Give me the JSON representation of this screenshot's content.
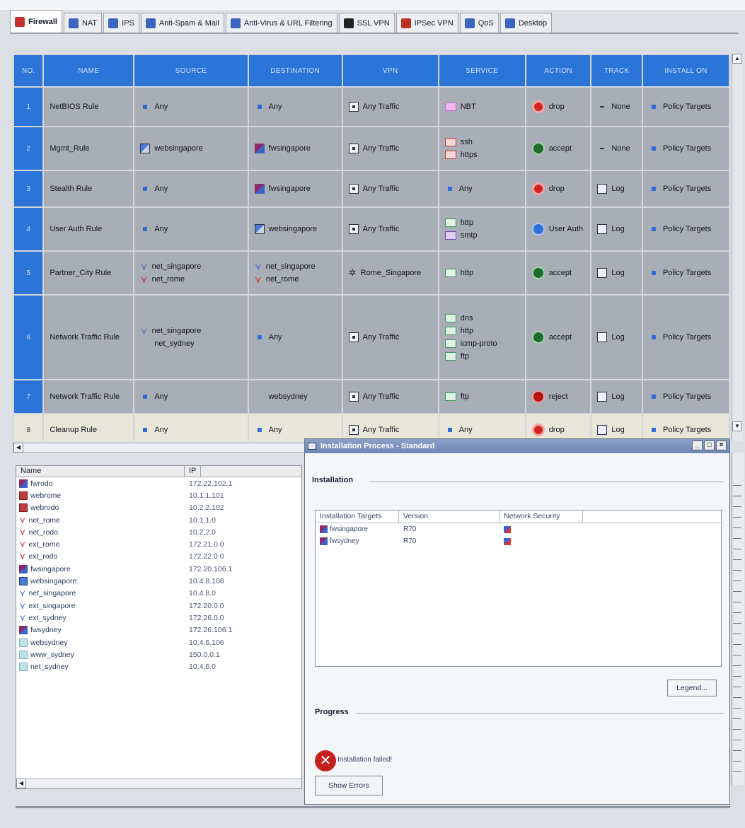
{
  "tabs": [
    {
      "label": "Firewall",
      "color": "#c43030"
    },
    {
      "label": "NAT",
      "color": "#3b64c0"
    },
    {
      "label": "IPS",
      "color": "#3b64c0"
    },
    {
      "label": "Anti-Spam & Mail",
      "color": "#3b64c0"
    },
    {
      "label": "Anti-Virus & URL Filtering",
      "color": "#3b64c0"
    },
    {
      "label": "SSL VPN",
      "color": "#222222"
    },
    {
      "label": "IPSec VPN",
      "color": "#b8321f"
    },
    {
      "label": "QoS",
      "color": "#3b64c0"
    },
    {
      "label": "Desktop",
      "color": "#3b64c0"
    }
  ],
  "rulebase": {
    "headers": [
      "NO.",
      "NAME",
      "SOURCE",
      "DESTINATION",
      "VPN",
      "SERVICE",
      "ACTION",
      "TRACK",
      "INSTALL ON"
    ],
    "rows": [
      {
        "no": "1",
        "name": "NetBIOS Rule",
        "source": [
          {
            "icon": "dot",
            "text": "Any"
          }
        ],
        "destination": [
          {
            "icon": "dot",
            "text": "Any"
          }
        ],
        "vpn": [
          {
            "icon": "vpnbox",
            "text": "Any Traffic"
          }
        ],
        "service": [
          {
            "icon": "svc pink",
            "text": "NBT"
          }
        ],
        "action": {
          "icon": "drop",
          "text": "drop"
        },
        "track": {
          "icon": "none",
          "text": "None"
        },
        "install": "Policy Targets"
      },
      {
        "no": "2",
        "name": "Mgmt_Rule",
        "source": [
          {
            "icon": "host",
            "text": "websingapore"
          }
        ],
        "destination": [
          {
            "icon": "gw",
            "text": "fwsingapore"
          }
        ],
        "vpn": [
          {
            "icon": "vpnbox",
            "text": "Any Traffic"
          }
        ],
        "service": [
          {
            "icon": "svc red",
            "text": "ssh"
          },
          {
            "icon": "svc red",
            "text": "https"
          }
        ],
        "action": {
          "icon": "accept",
          "text": "accept"
        },
        "track": {
          "icon": "none",
          "text": "None"
        },
        "install": "Policy Targets"
      },
      {
        "no": "3",
        "name": "Stealth Rule",
        "source": [
          {
            "icon": "dot",
            "text": "Any"
          }
        ],
        "destination": [
          {
            "icon": "gw",
            "text": "fwsingapore"
          }
        ],
        "vpn": [
          {
            "icon": "vpnbox",
            "text": "Any Traffic"
          }
        ],
        "service": [
          {
            "icon": "dot",
            "text": "Any"
          }
        ],
        "action": {
          "icon": "drop",
          "text": "drop"
        },
        "track": {
          "icon": "log",
          "text": "Log"
        },
        "install": "Policy Targets"
      },
      {
        "no": "4",
        "name": "User Auth Rule",
        "source": [
          {
            "icon": "dot",
            "text": "Any"
          }
        ],
        "destination": [
          {
            "icon": "host",
            "text": "websingapore"
          }
        ],
        "vpn": [
          {
            "icon": "vpnbox",
            "text": "Any Traffic"
          }
        ],
        "service": [
          {
            "icon": "svc",
            "text": "http"
          },
          {
            "icon": "svc purple",
            "text": "smtp"
          }
        ],
        "action": {
          "icon": "userauth",
          "text": "User Auth"
        },
        "track": {
          "icon": "log",
          "text": "Log"
        },
        "install": "Policy Targets"
      },
      {
        "no": "5",
        "name": "Partner_City Rule",
        "source": [
          {
            "icon": "net blue",
            "text": "net_singapore"
          },
          {
            "icon": "net",
            "text": "net_rome"
          }
        ],
        "destination": [
          {
            "icon": "net blue",
            "text": "net_singapore"
          },
          {
            "icon": "net",
            "text": "net_rome"
          }
        ],
        "vpn": [
          {
            "icon": "vpnstar",
            "text": "Rome_Singapore"
          }
        ],
        "service": [
          {
            "icon": "svc",
            "text": "http"
          }
        ],
        "action": {
          "icon": "accept",
          "text": "accept"
        },
        "track": {
          "icon": "log",
          "text": "Log"
        },
        "install": "Policy Targets"
      },
      {
        "no": "6",
        "name": "Network Traffic Rule",
        "source": [
          {
            "icon": "net blue",
            "text": "net_singapore"
          },
          {
            "icon": "none-ico",
            "text": "net_sydney"
          }
        ],
        "destination": [
          {
            "icon": "dot",
            "text": "Any"
          }
        ],
        "vpn": [
          {
            "icon": "vpnbox",
            "text": "Any Traffic"
          }
        ],
        "service": [
          {
            "icon": "svc",
            "text": "dns"
          },
          {
            "icon": "svc",
            "text": "http"
          },
          {
            "icon": "svc",
            "text": "icmp-proto"
          },
          {
            "icon": "svc",
            "text": "ftp"
          }
        ],
        "action": {
          "icon": "accept",
          "text": "accept"
        },
        "track": {
          "icon": "log",
          "text": "Log"
        },
        "install": "Policy Targets"
      },
      {
        "no": "7",
        "name": "Network Traffic Rule",
        "source": [
          {
            "icon": "dot",
            "text": "Any"
          }
        ],
        "destination": [
          {
            "icon": "none-ico",
            "text": "websydney"
          }
        ],
        "vpn": [
          {
            "icon": "vpnbox",
            "text": "Any Traffic"
          }
        ],
        "service": [
          {
            "icon": "svc",
            "text": "ftp"
          }
        ],
        "action": {
          "icon": "reject",
          "text": "reject"
        },
        "track": {
          "icon": "log",
          "text": "Log"
        },
        "install": "Policy Targets"
      },
      {
        "no": "8",
        "name": "Cleanup Rule",
        "source": [
          {
            "icon": "dot",
            "text": "Any"
          }
        ],
        "destination": [
          {
            "icon": "dot",
            "text": "Any"
          }
        ],
        "vpn": [
          {
            "icon": "vpnbox",
            "text": "Any Traffic"
          }
        ],
        "service": [
          {
            "icon": "dot",
            "text": "Any"
          }
        ],
        "action": {
          "icon": "drop",
          "text": "drop"
        },
        "track": {
          "icon": "log",
          "text": "Log"
        },
        "install": "Policy Targets"
      }
    ]
  },
  "objects": {
    "headers": [
      "Name",
      "IP"
    ],
    "rows": [
      {
        "icon": "gw",
        "name": "fwrodo",
        "ip": "172.22.102.1"
      },
      {
        "icon": "host",
        "name": "webrome",
        "ip": "10.1.1.101"
      },
      {
        "icon": "host",
        "name": "webrodo",
        "ip": "10.2.2.102"
      },
      {
        "icon": "net",
        "name": "net_rome",
        "ip": "10.1.1.0"
      },
      {
        "icon": "net",
        "name": "net_rodo",
        "ip": "10.2.2.0"
      },
      {
        "icon": "net",
        "name": "ext_rome",
        "ip": "172.21.0.0"
      },
      {
        "icon": "net",
        "name": "ext_rodo",
        "ip": "172.22.0.0"
      },
      {
        "icon": "gw",
        "name": "fwsingapore",
        "ip": "172.20.106.1"
      },
      {
        "icon": "host blue",
        "name": "websingapore",
        "ip": "10.4.8.108"
      },
      {
        "icon": "net blue",
        "name": "net_singapore",
        "ip": "10.4.8.0"
      },
      {
        "icon": "net blue",
        "name": "ext_singapore",
        "ip": "172.20.0.0"
      },
      {
        "icon": "net blue",
        "name": "ext_sydney",
        "ip": "172.26.0.0"
      },
      {
        "icon": "gw",
        "name": "fwsydney",
        "ip": "172.26.106.1"
      },
      {
        "icon": "range",
        "name": "websydney",
        "ip": "10.4.6.106"
      },
      {
        "icon": "range",
        "name": "www_sydney",
        "ip": "150.0.0.1"
      },
      {
        "icon": "range",
        "name": "net_sydney",
        "ip": "10.4.6.0"
      }
    ]
  },
  "dialog": {
    "title": "Installation Process - Standard",
    "installation_label": "Installation",
    "targets_headers": [
      "Installation Targets",
      "Version",
      "Network Security"
    ],
    "targets": [
      {
        "name": "fwsingapore",
        "version": "R70"
      },
      {
        "name": "fwsydney",
        "version": "R70"
      }
    ],
    "legend_button": "Legend...",
    "progress_label": "Progress",
    "status_text": "Installation failed!",
    "show_errors_button": "Show Errors"
  }
}
